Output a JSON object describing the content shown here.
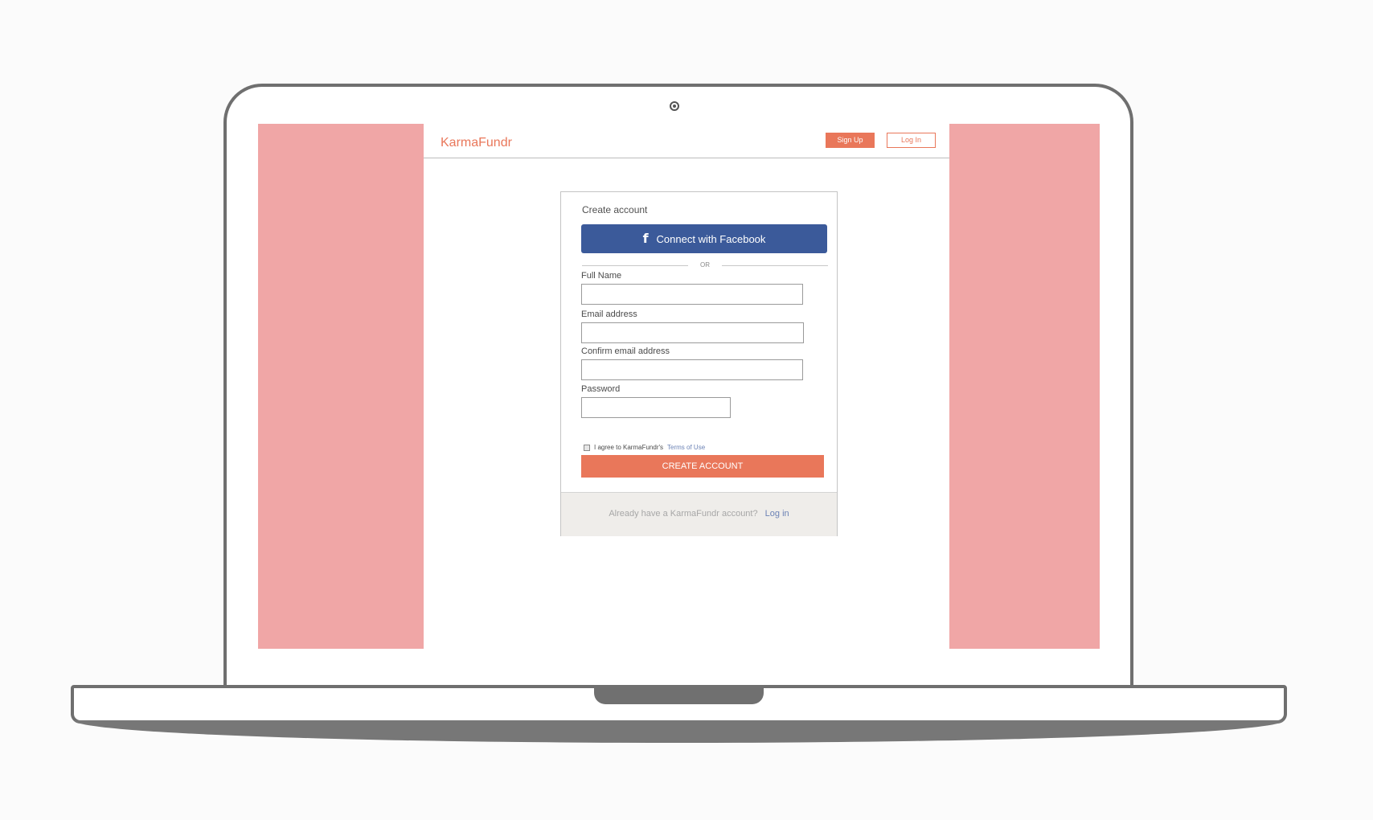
{
  "site": {
    "brand": "KarmaFundr",
    "nav": {
      "signup_label": "Sign Up",
      "login_label": "Log In"
    }
  },
  "form": {
    "title": "Create account",
    "facebook_label": "Connect with Facebook",
    "facebook_icon": "f",
    "or_label": "OR",
    "fields": {
      "full_name": {
        "label": "Full Name",
        "value": ""
      },
      "email": {
        "label": "Email address",
        "value": ""
      },
      "confirm_email": {
        "label": "Confirm email address",
        "value": ""
      },
      "password": {
        "label": "Password",
        "value": ""
      }
    },
    "agree_text": "I agree to KarmaFundr's",
    "terms_link": "Terms of Use",
    "agree_checked": false,
    "submit_label": "CREATE ACCOUNT",
    "footer_text": "Already have a KarmaFundr account?",
    "footer_link": "Log in"
  },
  "colors": {
    "accent": "#e9775a",
    "facebook": "#3b5a9a",
    "side_panels": "#f0a6a6",
    "link": "#6b82b5"
  }
}
